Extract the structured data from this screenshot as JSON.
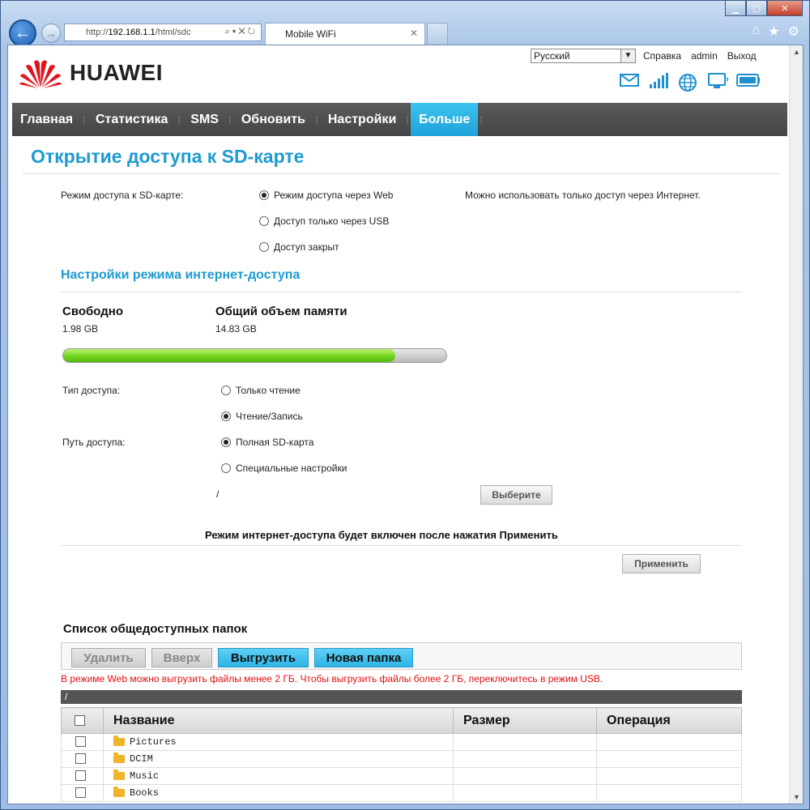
{
  "browser": {
    "address_host": "192.168.1.1",
    "address_prefix": "http://",
    "address_path": "/html/sdc",
    "tab_title": "Mobile WiFi"
  },
  "header": {
    "brand": "HUAWEI",
    "language": "Русский",
    "help": "Справка",
    "user": "admin",
    "logout": "Выход"
  },
  "menu": {
    "items": [
      "Главная",
      "Статистика",
      "SMS",
      "Обновить",
      "Настройки",
      "Больше"
    ],
    "active_index": 5
  },
  "page": {
    "title": "Открытие доступа к SD-карте",
    "sd_mode_label": "Режим доступа к SD-карте:",
    "sd_modes": [
      "Режим доступа через Web",
      "Доступ только через USB",
      "Доступ закрыт"
    ],
    "sd_mode_selected": 0,
    "sd_mode_hint": "Можно использовать только доступ через Интернет.",
    "web_settings_title": "Настройки режима интернет-доступа",
    "free_label": "Свободно",
    "free_value": "1.98 GB",
    "total_label": "Общий объем памяти",
    "total_value": "14.83 GB",
    "used_fraction": 0.866,
    "access_type_label": "Тип доступа:",
    "access_types": [
      "Только чтение",
      "Чтение/Запись"
    ],
    "access_type_selected": 1,
    "access_path_label": "Путь доступа:",
    "access_paths": [
      "Полная SD-карта",
      "Специальные настройки"
    ],
    "access_path_selected": 0,
    "path_value": "/",
    "select_button": "Выберите",
    "apply_note": "Режим интернет-доступа будет включен после нажатия Применить",
    "apply_button": "Применить"
  },
  "folders": {
    "title": "Список общедоступных папок",
    "toolbar": {
      "delete": "Удалить",
      "up": "Вверх",
      "upload": "Выгрузить",
      "new_folder": "Новая папка"
    },
    "warning": "В режиме Web можно выгрузить файлы менее 2 ГБ. Чтобы выгрузить файлы более 2 ГБ, переключитесь в режим USB.",
    "current_path": "/",
    "columns": [
      "Название",
      "Размер",
      "Операция"
    ],
    "rows": [
      {
        "name": "Pictures",
        "size": "",
        "op": ""
      },
      {
        "name": "DCIM",
        "size": "",
        "op": ""
      },
      {
        "name": "Music",
        "size": "",
        "op": ""
      },
      {
        "name": "Books",
        "size": "",
        "op": ""
      }
    ]
  },
  "colors": {
    "accent": "#1d9ad1",
    "menu_active": "#2db4e8",
    "warning": "#e01010",
    "progress": "#6dd11a"
  },
  "icons": [
    "mail-icon",
    "signal-icon",
    "globe-icon",
    "computer-icon",
    "battery-icon"
  ]
}
